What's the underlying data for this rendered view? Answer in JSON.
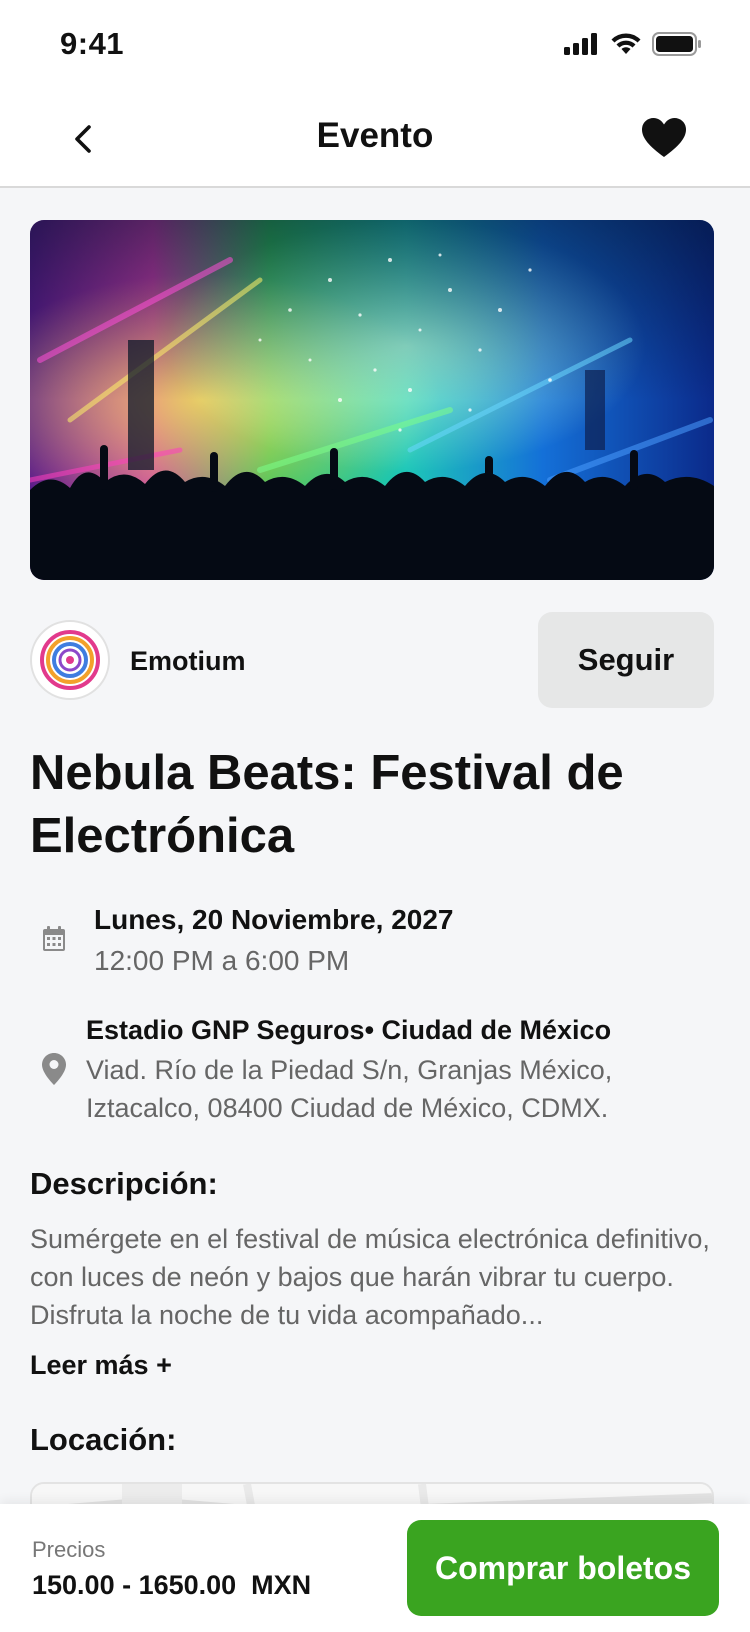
{
  "status_bar": {
    "time": "9:41"
  },
  "header": {
    "title": "Evento"
  },
  "organizer": {
    "name": "Emotium",
    "follow_label": "Seguir"
  },
  "event": {
    "title": "Nebula Beats: Festival de Electrónica",
    "date": "Lunes, 20 Noviembre, 2027",
    "time": "12:00 PM a 6:00 PM",
    "venue": "Estadio GNP Seguros• Ciudad de México",
    "address": "Viad. Río de la Piedad S/n, Granjas México, Iztacalco, 08400 Ciudad de México, CDMX."
  },
  "description": {
    "heading": "Descripción:",
    "text": "Sumérgete en el festival de música electrónica definitivo, con luces de neón y bajos que harán vibrar tu cuerpo. Disfruta la noche de tu vida acompañado...",
    "read_more": "Leer más +"
  },
  "location": {
    "heading": "Locación:"
  },
  "footer": {
    "price_label": "Precios",
    "price_range": "150.00 - 1650.00  MXN",
    "buy_label": "Comprar boletos"
  },
  "colors": {
    "accent": "#3aa420",
    "follow_bg": "#e6e7e7",
    "page_bg": "#f5f6f8"
  },
  "icons": [
    "signal-icon",
    "wifi-icon",
    "battery-icon",
    "back-arrow-icon",
    "heart-icon",
    "calendar-icon",
    "location-pin-icon"
  ]
}
